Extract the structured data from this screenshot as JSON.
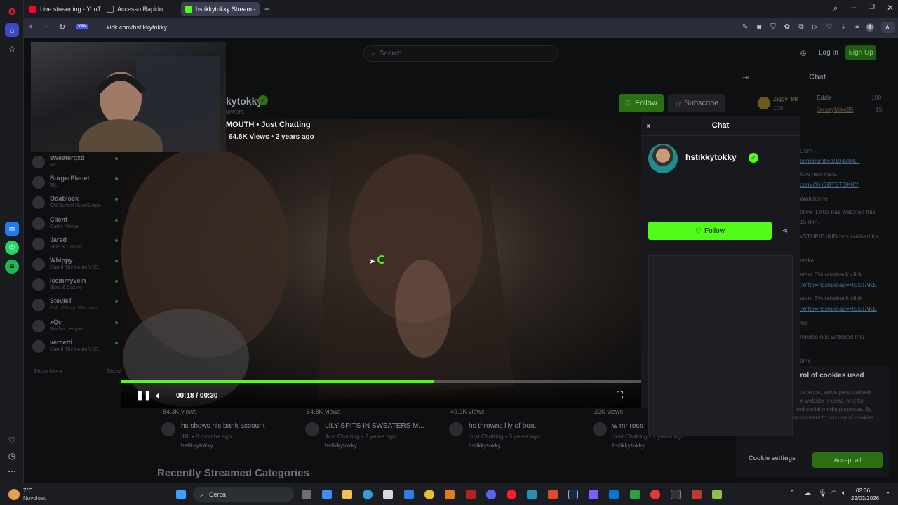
{
  "tabs": [
    {
      "label": "Live streaming - YouTube",
      "color": "#ff0033"
    },
    {
      "label": "Accesso Rapido",
      "color": "#8a8d93"
    },
    {
      "label": "hstikkytokky Stream -",
      "color": "#53fc18"
    }
  ],
  "address": {
    "url": "kick.com/hstikkytokky",
    "vpn": "VPN",
    "ai": "AI"
  },
  "header": {
    "search_placeholder": "Search",
    "login": "Log In",
    "signup": "Sign Up"
  },
  "sidebar": {
    "channels": [
      {
        "name": "sweatergxd",
        "category": "IRL"
      },
      {
        "name": "BurgerPlanet",
        "category": "IRL"
      },
      {
        "name": "Odablock",
        "category": "Old School RuneScape"
      },
      {
        "name": "Client",
        "category": "Gartic Phone"
      },
      {
        "name": "Jared",
        "category": "Slots & Casino"
      },
      {
        "name": "Whippy",
        "category": "Grand Theft Auto V (G..."
      },
      {
        "name": "Iceinmyvein",
        "category": "Slots & Casino"
      },
      {
        "name": "StevieT",
        "category": "Call of Duty: Warzone"
      },
      {
        "name": "xQc",
        "category": "Rocket League"
      },
      {
        "name": "vercetti",
        "category": "Grand Theft Auto V (G..."
      }
    ],
    "show_more": "Show More",
    "show": "Show"
  },
  "stream": {
    "name": "kytokky",
    "followers": "lowers",
    "title": "MOUTH • Just Chatting",
    "views": "64.8K Views • 2 years ago",
    "follow": "Follow",
    "subscribe": "Subscribe"
  },
  "player": {
    "time": "00:18 / 00:30",
    "progress": 0.6
  },
  "chat_bg": {
    "title": "Chat",
    "top_users": [
      {
        "name": "Ziggy_89",
        "count": "100"
      },
      {
        "name": "Eddie",
        "count": "100"
      },
      {
        "name": "JerseyMike95",
        "count": "15"
      }
    ],
    "lines": [
      "Com -",
      "communities/194384...",
      "llow new insta",
      "com/@HSBTSTOKKY",
      "Watchtime",
      "ctive_LA03 has watched this",
      "15 min.",
      "xSTUPIDxKID has subbed for",
      "stake",
      "stant 5% rakeback click",
      "?offer=hsstake&c=HSSTAKE",
      "stant 5% rakeback click",
      "?offer=hsstake&c=HSSTAKE",
      "me",
      "rhodes has watched this",
      "time"
    ]
  },
  "cookie": {
    "title": "trol of cookies used",
    "body": "es use cookies to enhance ience, serve personalized content, measure how the website is used, and for advertising, marketing and social media purposes. By clicking \"Accept all\", you consent to our use of cookies.",
    "settings": "Cookie settings",
    "accept": "Accept all"
  },
  "popout": {
    "title": "Chat",
    "username": "hstikkytokky",
    "follow": "Follow"
  },
  "videos": [
    {
      "views": "84.3K views",
      "title": "hs shows his bank account",
      "category": "IRL",
      "age": "8 months ago",
      "channel": "hstikkytokky"
    },
    {
      "views": "64.8K views",
      "title": "LILY SPITS IN SWEATERS M...",
      "category": "Just Chatting",
      "age": "2 years ago",
      "channel": "hstikkytokky"
    },
    {
      "views": "49.9K views",
      "title": "hs throwns lily of boat",
      "category": "Just Chatting",
      "age": "3 years ago",
      "channel": "hstikkytokky"
    },
    {
      "views": "22K views",
      "title": "w mr ross",
      "category": "Just Chatting",
      "age": "2 years ago",
      "channel": "hstikkytokky"
    }
  ],
  "recent_title": "Recently Streamed Categories",
  "taskbar": {
    "weather_temp": "7°C",
    "weather_desc": "Nuvoloso",
    "search": "Cerca",
    "time": "02:36",
    "date": "22/03/2026"
  }
}
